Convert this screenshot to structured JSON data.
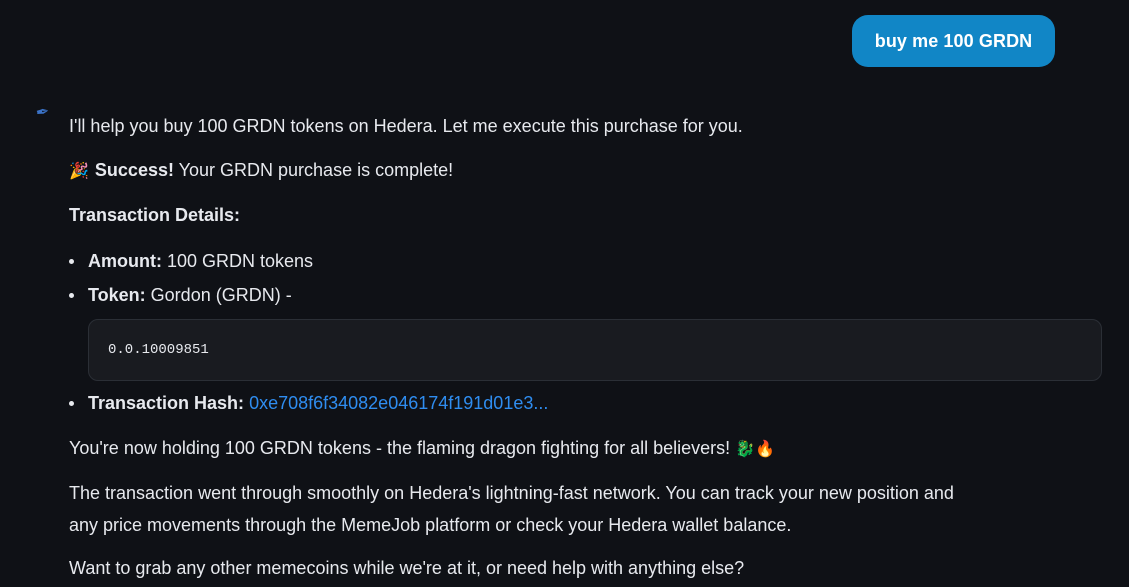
{
  "user_message": {
    "text": "buy me 100 GRDN"
  },
  "assistant": {
    "avatar_icon": "pen-nib-icon",
    "intro": "I'll help you buy 100 GRDN tokens on Hedera. Let me execute this purchase for you.",
    "success": {
      "emoji": "🎉",
      "label": "Success!",
      "text": " Your GRDN purchase is complete!"
    },
    "details_heading": "Transaction Details:",
    "details": {
      "amount_label": "Amount:",
      "amount_value": " 100 GRDN tokens",
      "token_label": "Token:",
      "token_value": " Gordon (GRDN) -",
      "token_id": "0.0.10009851",
      "hash_label": "Transaction Hash:",
      "hash_value": "0xe708f6f34082e046174f191d01e3..."
    },
    "holding": {
      "text": "You're now holding 100 GRDN tokens - the flaming dragon fighting for all believers! ",
      "emoji_dragon": "🐉",
      "emoji_fire": "🔥"
    },
    "paragraph_line1": "The transaction went through smoothly on Hedera's lightning-fast network. You can track your new position and",
    "paragraph_line2": "any price movements through the MemeJob platform or check your Hedera wallet balance.",
    "closing": "Want to grab any other memecoins while we're at it, or need help with anything else?"
  },
  "colors": {
    "background": "#0f1116",
    "user_bubble": "#1186c6",
    "link": "#2f8df0",
    "code_bg": "#191b20"
  }
}
